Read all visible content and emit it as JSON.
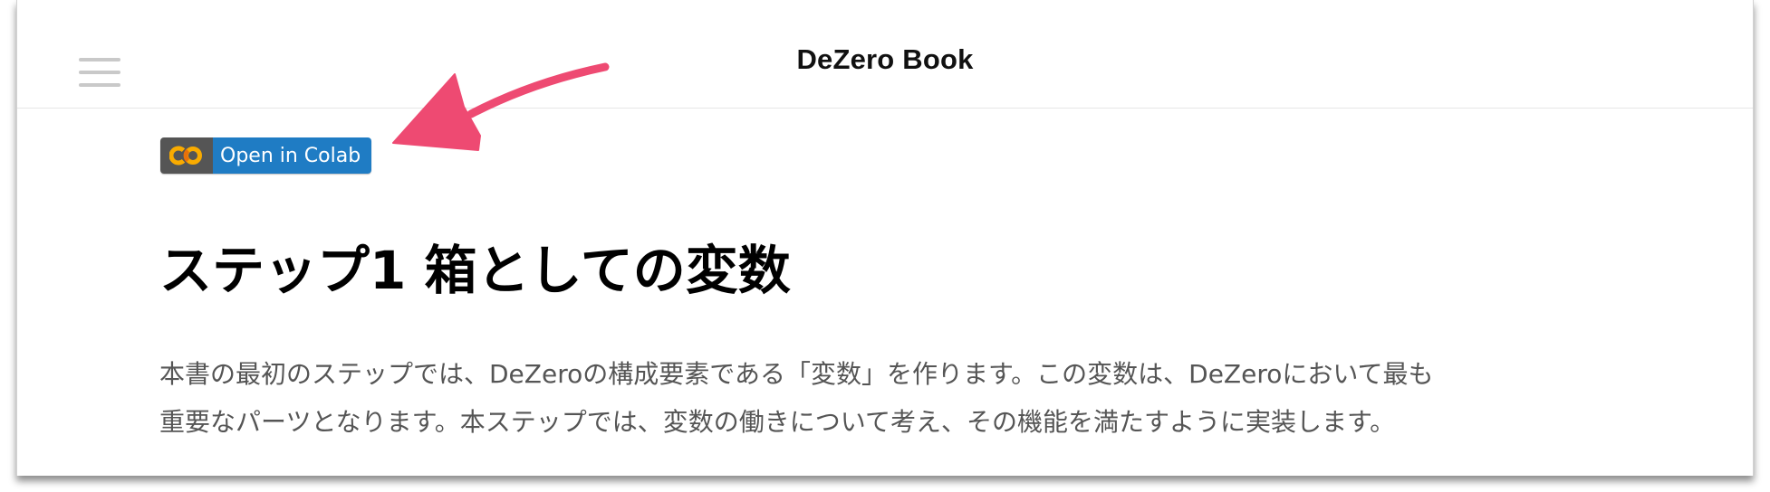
{
  "header": {
    "site_title": "DeZero Book",
    "menu_icon": "hamburger-menu-icon"
  },
  "badge": {
    "logo_text": "CO",
    "label": "Open in Colab",
    "logo_color": "#F9AB00",
    "label_bg": "#1F7CC4",
    "logo_bg": "#555555"
  },
  "content": {
    "heading": "ステップ1 箱としての変数",
    "paragraph_lines": [
      "本書の最初のステップでは、DeZeroの構成要素である「変数」を作ります。この変数は、DeZeroにおいて最も",
      "重要なパーツとなります。本ステップでは、変数の働きについて考え、その機能を満たすように実装します。"
    ]
  },
  "annotation": {
    "arrow_icon": "pointer-arrow-icon",
    "arrow_color": "#EE4A72"
  }
}
